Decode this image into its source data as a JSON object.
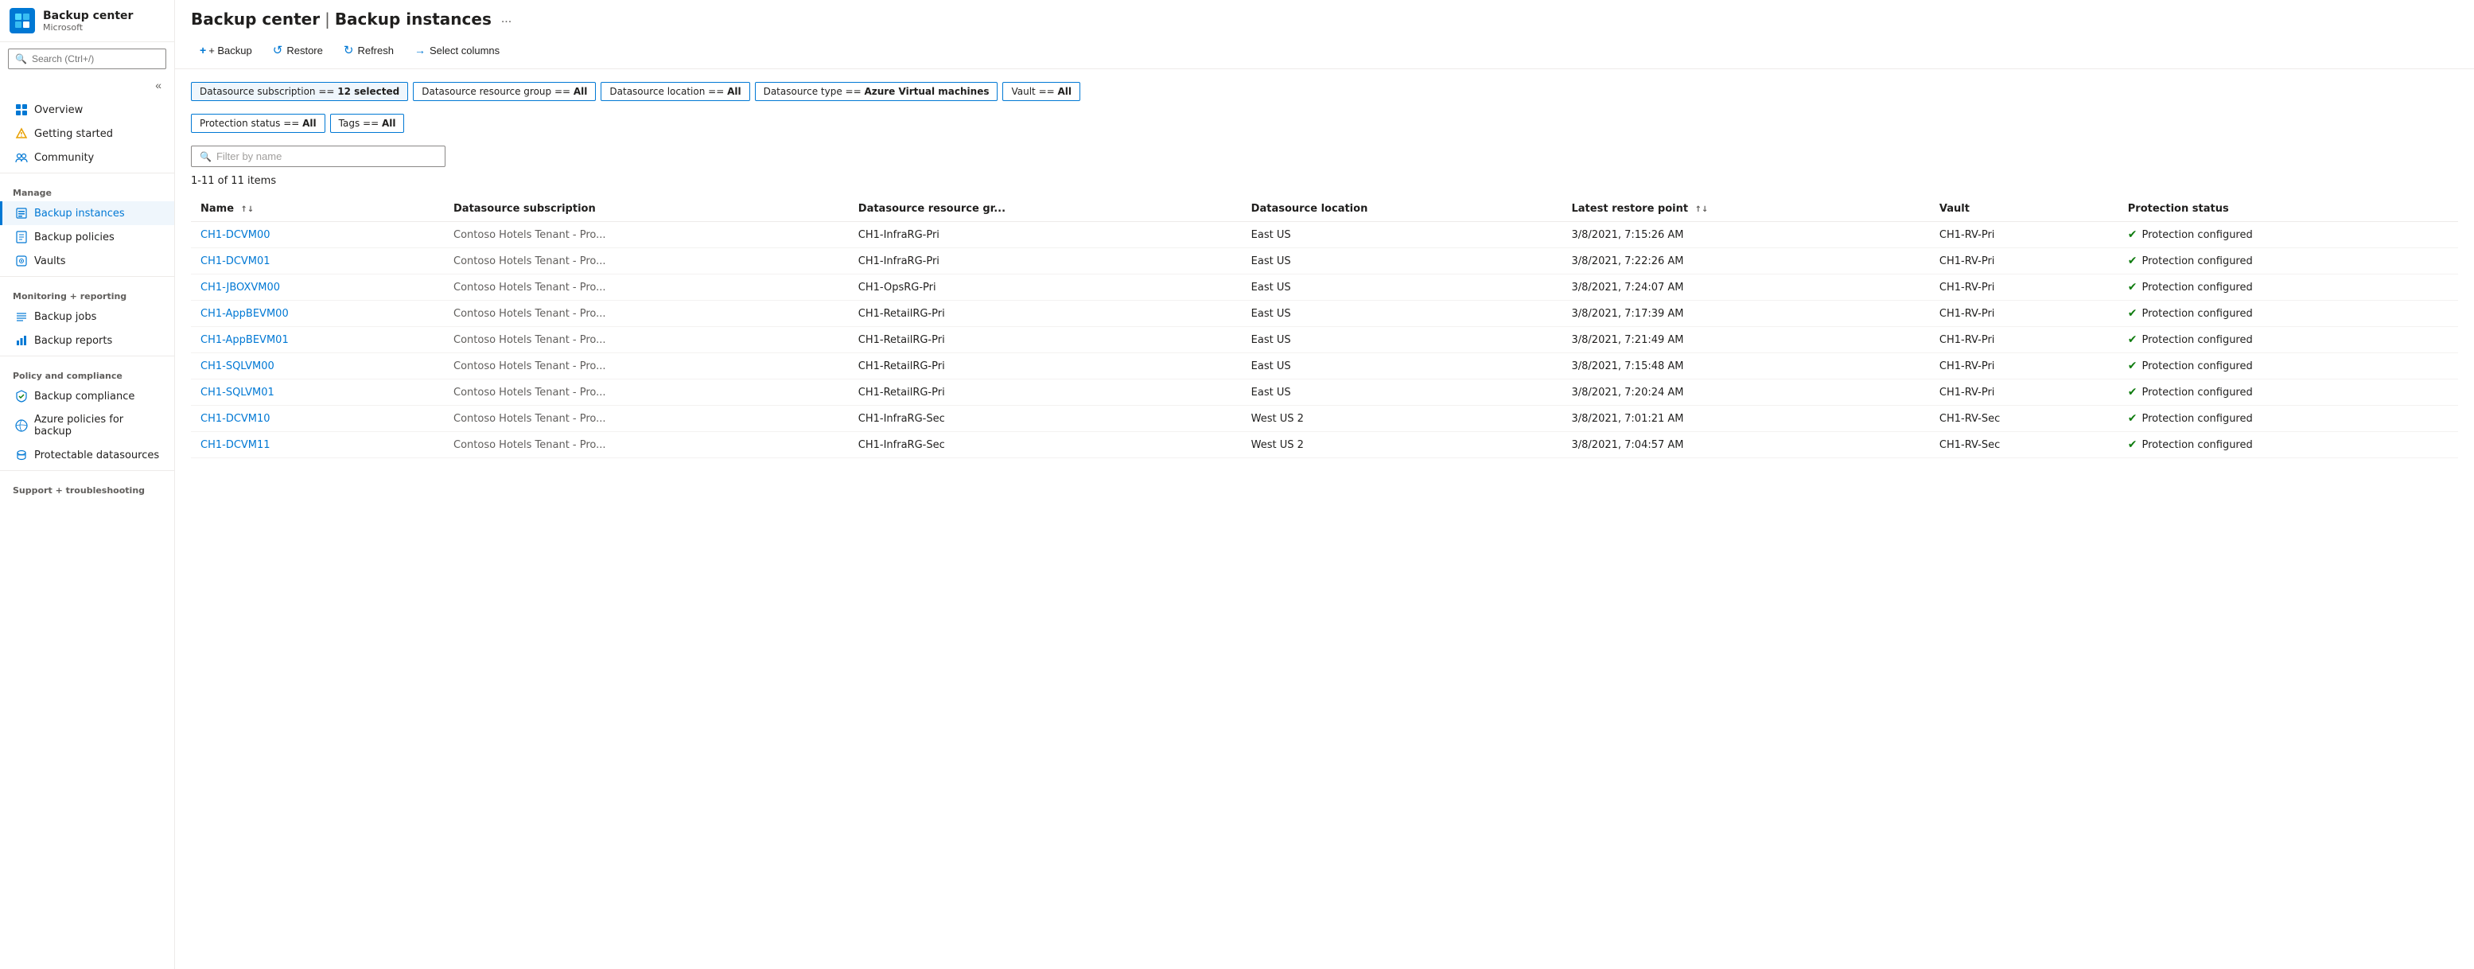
{
  "app": {
    "name": "Backup center",
    "subtitle": "Microsoft",
    "separator": "|",
    "page": "Backup instances",
    "ellipsis": "..."
  },
  "sidebar": {
    "search_placeholder": "Search (Ctrl+/)",
    "collapse_icon": "«",
    "nav_items": [
      {
        "id": "overview",
        "label": "Overview",
        "icon": "grid"
      },
      {
        "id": "getting-started",
        "label": "Getting started",
        "icon": "flag"
      },
      {
        "id": "community",
        "label": "Community",
        "icon": "people"
      }
    ],
    "sections": [
      {
        "label": "Manage",
        "items": [
          {
            "id": "backup-instances",
            "label": "Backup instances",
            "icon": "db",
            "active": true
          },
          {
            "id": "backup-policies",
            "label": "Backup policies",
            "icon": "policy"
          },
          {
            "id": "vaults",
            "label": "Vaults",
            "icon": "vault"
          }
        ]
      },
      {
        "label": "Monitoring + reporting",
        "items": [
          {
            "id": "backup-jobs",
            "label": "Backup jobs",
            "icon": "jobs"
          },
          {
            "id": "backup-reports",
            "label": "Backup reports",
            "icon": "reports"
          }
        ]
      },
      {
        "label": "Policy and compliance",
        "items": [
          {
            "id": "backup-compliance",
            "label": "Backup compliance",
            "icon": "compliance"
          },
          {
            "id": "azure-policies",
            "label": "Azure policies for backup",
            "icon": "azure-policy"
          },
          {
            "id": "protectable-datasources",
            "label": "Protectable datasources",
            "icon": "datasource"
          }
        ]
      },
      {
        "label": "Support + troubleshooting",
        "items": []
      }
    ]
  },
  "toolbar": {
    "backup_label": "+ Backup",
    "restore_label": "Restore",
    "refresh_label": "Refresh",
    "select_columns_label": "Select columns"
  },
  "filters": {
    "chips": [
      {
        "id": "subscription",
        "text": "Datasource subscription == ",
        "value": "12 selected",
        "selected": true
      },
      {
        "id": "resource-group",
        "text": "Datasource resource group == ",
        "value": "All",
        "selected": false
      },
      {
        "id": "location",
        "text": "Datasource location == ",
        "value": "All",
        "selected": false
      },
      {
        "id": "type",
        "text": "Datasource type == ",
        "value": "Azure Virtual machines",
        "selected": false
      },
      {
        "id": "vault",
        "text": "Vault == ",
        "value": "All",
        "selected": false
      },
      {
        "id": "protection-status",
        "text": "Protection status == ",
        "value": "All",
        "selected": false
      },
      {
        "id": "tags",
        "text": "Tags == ",
        "value": "All",
        "selected": false
      }
    ],
    "search_placeholder": "Filter by name"
  },
  "table": {
    "items_count": "1-11 of 11 items",
    "columns": [
      {
        "id": "name",
        "label": "Name",
        "sortable": true
      },
      {
        "id": "subscription",
        "label": "Datasource subscription",
        "sortable": false
      },
      {
        "id": "resource-group",
        "label": "Datasource resource gr...",
        "sortable": false
      },
      {
        "id": "location",
        "label": "Datasource location",
        "sortable": false
      },
      {
        "id": "restore-point",
        "label": "Latest restore point",
        "sortable": true
      },
      {
        "id": "vault",
        "label": "Vault",
        "sortable": false
      },
      {
        "id": "protection-status",
        "label": "Protection status",
        "sortable": false
      }
    ],
    "rows": [
      {
        "name": "CH1-DCVM00",
        "subscription": "Contoso Hotels Tenant - Pro...",
        "resource_group": "CH1-InfraRG-Pri",
        "location": "East US",
        "restore_point": "3/8/2021, 7:15:26 AM",
        "vault": "CH1-RV-Pri",
        "status": "Protection configured"
      },
      {
        "name": "CH1-DCVM01",
        "subscription": "Contoso Hotels Tenant - Pro...",
        "resource_group": "CH1-InfraRG-Pri",
        "location": "East US",
        "restore_point": "3/8/2021, 7:22:26 AM",
        "vault": "CH1-RV-Pri",
        "status": "Protection configured"
      },
      {
        "name": "CH1-JBOXVM00",
        "subscription": "Contoso Hotels Tenant - Pro...",
        "resource_group": "CH1-OpsRG-Pri",
        "location": "East US",
        "restore_point": "3/8/2021, 7:24:07 AM",
        "vault": "CH1-RV-Pri",
        "status": "Protection configured"
      },
      {
        "name": "CH1-AppBEVM00",
        "subscription": "Contoso Hotels Tenant - Pro...",
        "resource_group": "CH1-RetailRG-Pri",
        "location": "East US",
        "restore_point": "3/8/2021, 7:17:39 AM",
        "vault": "CH1-RV-Pri",
        "status": "Protection configured"
      },
      {
        "name": "CH1-AppBEVM01",
        "subscription": "Contoso Hotels Tenant - Pro...",
        "resource_group": "CH1-RetailRG-Pri",
        "location": "East US",
        "restore_point": "3/8/2021, 7:21:49 AM",
        "vault": "CH1-RV-Pri",
        "status": "Protection configured"
      },
      {
        "name": "CH1-SQLVM00",
        "subscription": "Contoso Hotels Tenant - Pro...",
        "resource_group": "CH1-RetailRG-Pri",
        "location": "East US",
        "restore_point": "3/8/2021, 7:15:48 AM",
        "vault": "CH1-RV-Pri",
        "status": "Protection configured"
      },
      {
        "name": "CH1-SQLVM01",
        "subscription": "Contoso Hotels Tenant - Pro...",
        "resource_group": "CH1-RetailRG-Pri",
        "location": "East US",
        "restore_point": "3/8/2021, 7:20:24 AM",
        "vault": "CH1-RV-Pri",
        "status": "Protection configured"
      },
      {
        "name": "CH1-DCVM10",
        "subscription": "Contoso Hotels Tenant - Pro...",
        "resource_group": "CH1-InfraRG-Sec",
        "location": "West US 2",
        "restore_point": "3/8/2021, 7:01:21 AM",
        "vault": "CH1-RV-Sec",
        "status": "Protection configured"
      },
      {
        "name": "CH1-DCVM11",
        "subscription": "Contoso Hotels Tenant - Pro...",
        "resource_group": "CH1-InfraRG-Sec",
        "location": "West US 2",
        "restore_point": "3/8/2021, 7:04:57 AM",
        "vault": "CH1-RV-Sec",
        "status": "Protection configured"
      }
    ]
  },
  "icons": {
    "search": "🔍",
    "backup": "+",
    "restore": "↺",
    "refresh": "↺",
    "arrow_right": "→",
    "sort": "↑↓",
    "check_circle": "✔",
    "grid": "⊞",
    "flag": "⚑",
    "people": "👥",
    "db": "🗄",
    "policy": "📋",
    "vault": "🏛",
    "jobs": "≡",
    "reports": "📊",
    "compliance": "🔒",
    "azure_policy": "☁",
    "datasource": "💾"
  }
}
